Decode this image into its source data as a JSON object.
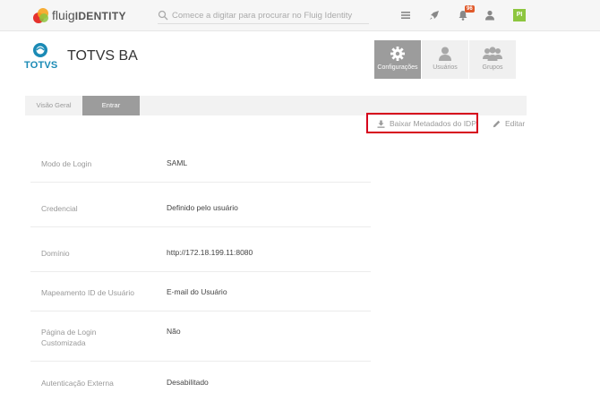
{
  "app": {
    "logo_text": "fluig",
    "logo_text_bold": "IDENTITY",
    "search_placeholder": "Comece a digitar para procurar no Fluig Identity",
    "notification_count": "96",
    "user_initials": "PI",
    "colors": {
      "accent_green": "#8dc63f",
      "badge": "#e05a2b",
      "highlight": "#d6001c"
    }
  },
  "company": {
    "logo_text": "TOTVS",
    "name": "TOTVS BA"
  },
  "nav": {
    "configuracoes": "Configurações",
    "usuarios": "Usuários",
    "grupos": "Grupos"
  },
  "tabs": {
    "visao_geral": "Visão Geral",
    "entrar": "Entrar"
  },
  "actions": {
    "baixar": "Baixar Metadados do IDP",
    "editar": "Editar"
  },
  "details": [
    {
      "label": "Modo de Login",
      "value": "SAML"
    },
    {
      "label": "Credencial",
      "value": "Definido pelo usuário"
    },
    {
      "label": "Domínio",
      "value": "http://172.18.199.11:8080"
    },
    {
      "label": "Mapeamento ID de Usuário",
      "value": "E-mail do Usuário"
    },
    {
      "label": "Página de Login Customizada",
      "value": "Não"
    },
    {
      "label": "Autenticação Externa",
      "value": "Desabilitado"
    }
  ]
}
